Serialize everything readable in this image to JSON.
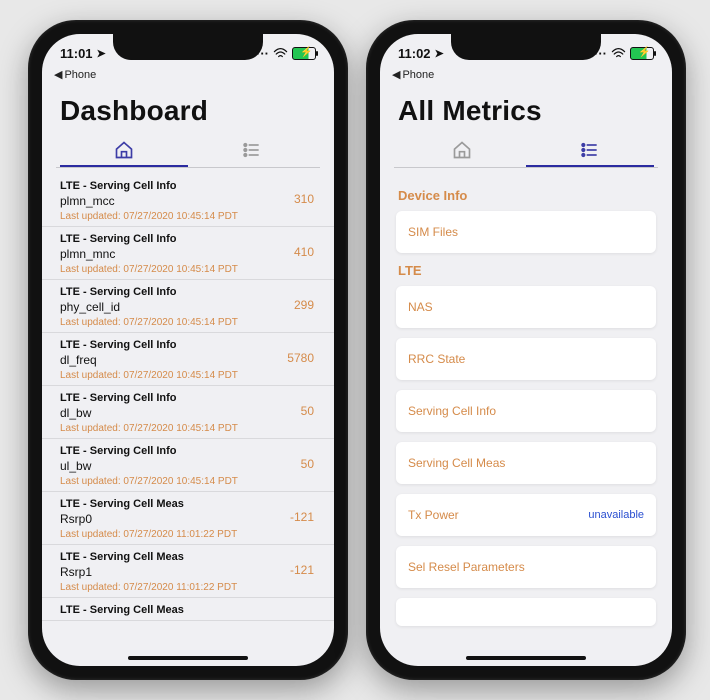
{
  "colors": {
    "accent_purple": "#2b2ba0",
    "accent_orange": "#d58b4a",
    "link_blue": "#2a4fd0"
  },
  "left": {
    "status_time": "11:01",
    "location_icon": "location-arrow",
    "breadcrumb_back": "Phone",
    "title": "Dashboard",
    "tab_active": "home",
    "rows": [
      {
        "cat": "LTE - Serving Cell Info",
        "name": "plmn_mcc",
        "updated": "Last updated: 07/27/2020 10:45:14 PDT",
        "val": "310"
      },
      {
        "cat": "LTE - Serving Cell Info",
        "name": "plmn_mnc",
        "updated": "Last updated: 07/27/2020 10:45:14 PDT",
        "val": "410"
      },
      {
        "cat": "LTE - Serving Cell Info",
        "name": "phy_cell_id",
        "updated": "Last updated: 07/27/2020 10:45:14 PDT",
        "val": "299"
      },
      {
        "cat": "LTE - Serving Cell Info",
        "name": "dl_freq",
        "updated": "Last updated: 07/27/2020 10:45:14 PDT",
        "val": "5780"
      },
      {
        "cat": "LTE - Serving Cell Info",
        "name": "dl_bw",
        "updated": "Last updated: 07/27/2020 10:45:14 PDT",
        "val": "50"
      },
      {
        "cat": "LTE - Serving Cell Info",
        "name": "ul_bw",
        "updated": "Last updated: 07/27/2020 10:45:14 PDT",
        "val": "50"
      },
      {
        "cat": "LTE - Serving Cell Meas",
        "name": "Rsrp0",
        "updated": "Last updated: 07/27/2020 11:01:22 PDT",
        "val": "-121"
      },
      {
        "cat": "LTE - Serving Cell Meas",
        "name": "Rsrp1",
        "updated": "Last updated: 07/27/2020 11:01:22 PDT",
        "val": "-121"
      },
      {
        "cat": "LTE - Serving Cell Meas",
        "name": "",
        "updated": "",
        "val": ""
      }
    ]
  },
  "right": {
    "status_time": "11:02",
    "location_icon": "location-arrow",
    "breadcrumb_back": "Phone",
    "title": "All Metrics",
    "tab_active": "list",
    "sections": [
      {
        "head": "Device Info",
        "items": [
          {
            "label": "SIM Files",
            "status": ""
          }
        ]
      },
      {
        "head": "LTE",
        "items": [
          {
            "label": "NAS",
            "status": ""
          },
          {
            "label": "RRC State",
            "status": ""
          },
          {
            "label": "Serving Cell Info",
            "status": ""
          },
          {
            "label": "Serving Cell Meas",
            "status": ""
          },
          {
            "label": "Tx Power",
            "status": "unavailable"
          },
          {
            "label": "Sel Resel Parameters",
            "status": ""
          },
          {
            "label": "",
            "status": ""
          }
        ]
      }
    ]
  }
}
